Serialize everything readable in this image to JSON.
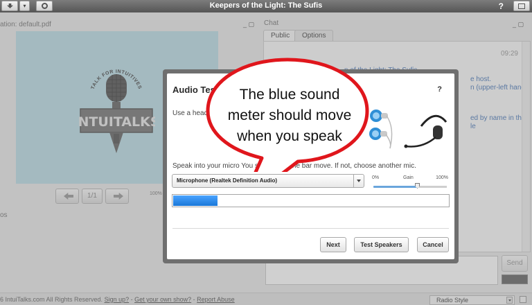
{
  "app": {
    "title": "Keepers of the Light: The Sufis",
    "help_label": "?"
  },
  "presentation": {
    "header": "ation: default.pdf",
    "win_controls": "_ ▢",
    "page_indicator": "1/1",
    "zoom_label": "100%",
    "side_label": "os",
    "logo": {
      "arc_text": "TALK FOR INTUITIVES",
      "brand_text": "INTUITALKS"
    }
  },
  "chat": {
    "header": "Chat",
    "win_controls": "_ ▢",
    "tabs": [
      {
        "label": "Public",
        "active": true
      },
      {
        "label": "Options",
        "active": false
      }
    ],
    "timestamp": "09:29",
    "messages": [
      "n of the Light: The Sufis",
      "e host.",
      "n (upper-left hand",
      "ed by name in the",
      "le"
    ],
    "send_label": "Send"
  },
  "footer": {
    "copyright": "6 IntuiTalks.com All Rights Reserved.",
    "links": [
      "Sign up?",
      "Get your own show?",
      "Report Abuse"
    ],
    "separator": " - ",
    "style_select": "Radio Style"
  },
  "dialog": {
    "title": "Audio Tes",
    "help": "?",
    "instruction": "Use a head",
    "speak_instruction": "Speak into your micro       You should see the bar move. If not, choose another mic.",
    "mic_selected": "Microphone (Realtek          Definition Audio)",
    "gain": {
      "label": "Gain",
      "min_label": "0%",
      "max_label": "100%",
      "value": 0.6
    },
    "meter_level": 0.16,
    "buttons": {
      "next": "Next",
      "test_speakers": "Test Speakers",
      "cancel": "Cancel"
    }
  },
  "annotation": {
    "text": "The blue sound\nmeter should move\nwhen you speak",
    "border_color": "#e0161c"
  },
  "colors": {
    "meter_blue": "#1a78d8",
    "link_blue": "#4a78b8",
    "titlebar": "#555555"
  }
}
